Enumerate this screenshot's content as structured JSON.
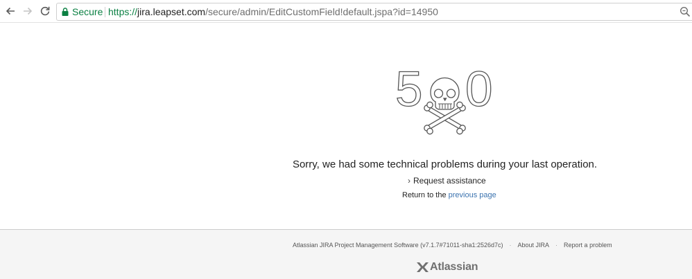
{
  "browser": {
    "secure_label": "Secure",
    "url_scheme": "https://",
    "url_host": "jira.leapset.com",
    "url_path": "/secure/admin/EditCustomField!default.jspa?id=14950",
    "icons": [
      "back-arrow-icon",
      "forward-arrow-icon",
      "reload-icon",
      "lock-icon",
      "zoom-icon"
    ]
  },
  "error": {
    "code_first_digit": "5",
    "code_last_digit": "0",
    "art_icon": "skull-crossbones-icon",
    "message": "Sorry, we had some technical problems during your last operation.",
    "assist_label": "Request assistance",
    "return_prefix": "Return to the ",
    "return_link": "previous page"
  },
  "footer": {
    "product_info": "Atlassian JIRA Project Management Software (v7.1.7#71011-sha1:2526d7c)",
    "separator": "·",
    "about_link": "About JIRA",
    "report_link": "Report a problem",
    "logo_text": "Atlassian"
  },
  "colors": {
    "secure_green": "#0b8043",
    "link_blue": "#3b73af",
    "footer_bg": "#f5f5f5"
  }
}
